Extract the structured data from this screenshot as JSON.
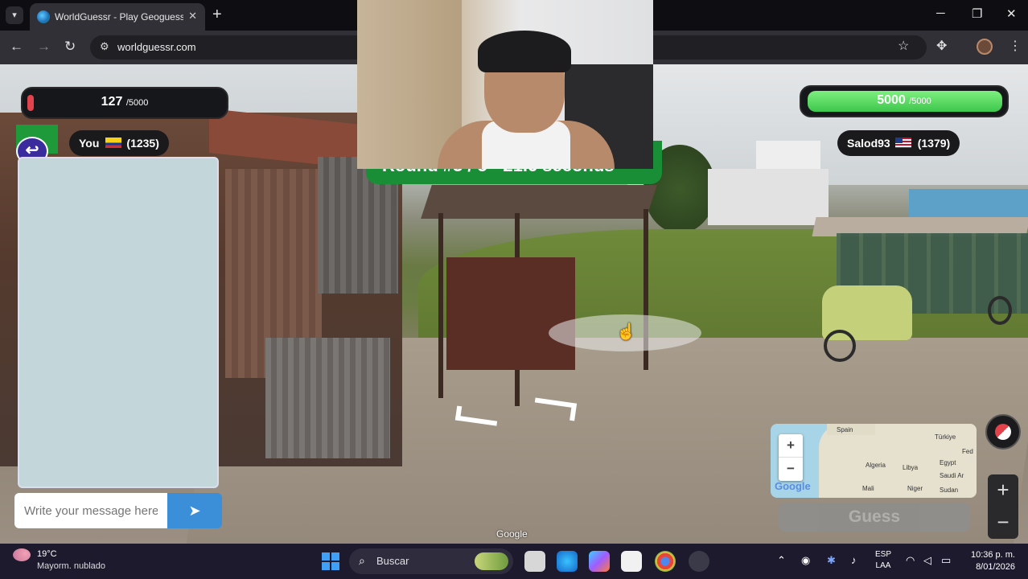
{
  "browser": {
    "tab_title": "WorldGuessr - Play Geoguessr Free",
    "url": "worldguessr.com",
    "tab_close": "✕",
    "new_tab": "+",
    "win_min": "─",
    "win_max": "❐",
    "win_close": "✕"
  },
  "game": {
    "left_hp": {
      "value": "127",
      "max": "/5000",
      "fill_fraction": 0.025,
      "color": "#e3434c"
    },
    "right_hp": {
      "value": "5000",
      "max": "/5000",
      "fill_fraction": 1.0,
      "color": "#3dc64c"
    },
    "player_you": {
      "name": "You",
      "score": "(1235)",
      "flag": "Colombia"
    },
    "player_opponent": {
      "name": "Salod93",
      "score": "(1379)",
      "flag": "United States"
    },
    "round_banner": "Round #3 / 5 - 21.6 seconds",
    "chat_placeholder": "Write your message here",
    "guess_label": "Guess",
    "zoom_in": "+",
    "zoom_out": "−",
    "map_zoom_in": "+",
    "map_zoom_out": "−",
    "map_brand": "Google",
    "streetview_brand": "Google",
    "map_labels": [
      "Spain",
      "Türkiye",
      "Algeria",
      "Libya",
      "Egypt",
      "Mali",
      "Niger",
      "Sudan",
      "Saudi Ar",
      "Fed"
    ],
    "accent_color": "#1a8e37"
  },
  "taskbar": {
    "weather_temp": "19°C",
    "weather_desc": "Mayorm. nublado",
    "search_label": "Buscar",
    "lang_top": "ESP",
    "lang_bottom": "LAA",
    "time": "10:36 p. m.",
    "date": "8/01/2026"
  }
}
